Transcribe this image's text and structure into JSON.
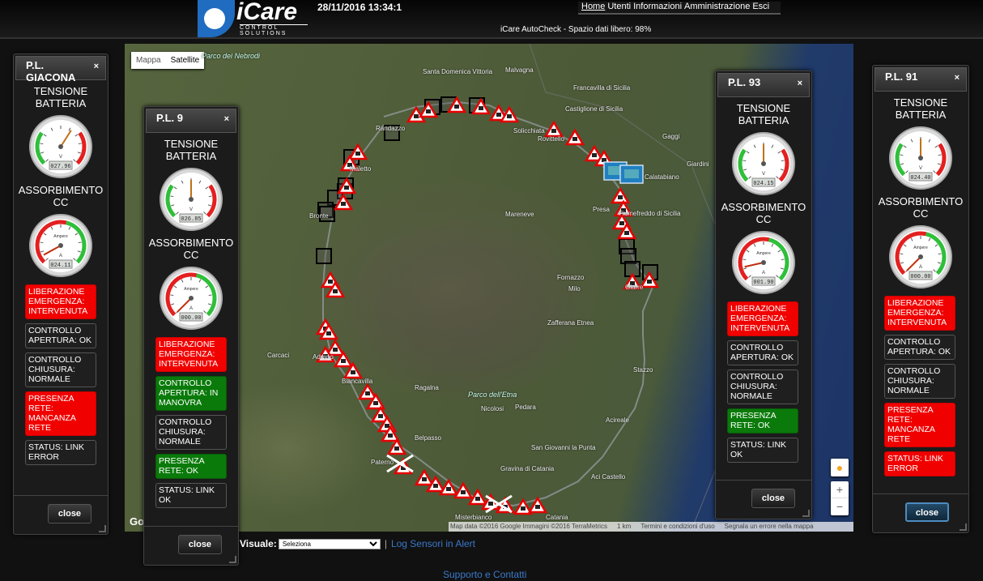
{
  "header": {
    "logo": {
      "brand": "iCare",
      "sub": "CONTROL SOLUTIONS"
    },
    "datetime": "28/11/2016 13:34:1",
    "nav": [
      "Home",
      "Utenti",
      "Informazioni",
      "Amministrazione",
      "Esci"
    ],
    "storage": "iCare AutoCheck - Spazio dati libero: 98%"
  },
  "map": {
    "map_types": [
      "Mappa",
      "Satellite"
    ],
    "selected_map_type": "Satellite",
    "attribution": [
      "Map data ©2016 Google Immagini ©2016 TerraMetrics",
      "1 km",
      "Termini e condizioni d'uso",
      "Segnala un errore nella mappa"
    ],
    "google_logo": "Google",
    "zoom_in": "+",
    "zoom_out": "−",
    "place_labels": [
      "Parco dei Nebrodi",
      "Santa Domenica Vittoria",
      "Malvagna",
      "Francavilla di Sicilia",
      "Castiglione di Sicilia",
      "Solicchiata",
      "Rovittello",
      "Randazzo",
      "Maletto",
      "Bronte",
      "Fiumefreddo di Sicilia",
      "Calatabiano",
      "Giardini",
      "Gaggi",
      "Mareneve",
      "Presa",
      "Fornazzo",
      "Milo",
      "Giarre",
      "Zafferana Etnea",
      "Adrano",
      "Biancavilla",
      "Carcaci",
      "Ragalna",
      "Parco dell'Etna",
      "Pedara",
      "Nicolosi",
      "Acireale",
      "Stazzo",
      "Belpasso",
      "San Giovanni la Punta",
      "Gravina di Catania",
      "Aci Castello",
      "Paternò",
      "Misterbianco",
      "Catania"
    ],
    "icon_colors": {
      "warning": "#e60000",
      "box": "#000000",
      "device": "#1f7fc0",
      "route": "#9aa0a6"
    }
  },
  "panels": [
    {
      "title": "P.L. GIACONA",
      "close_icon": "×",
      "gauge1": {
        "label": "TENSIONE BATTERIA",
        "unit": "V",
        "readout": "027.96",
        "value_fraction": 0.62
      },
      "gauge2": {
        "label": "ASSORBIMENTO CC",
        "unit": "A",
        "caption": "Ampere",
        "readout": "024.11",
        "value_fraction": 0.06
      },
      "statuses": [
        {
          "text": "LIBERAZIONE EMERGENZA: INTERVENUTA",
          "color": "red"
        },
        {
          "text": "CONTROLLO APERTURA: OK",
          "color": "gray"
        },
        {
          "text": "CONTROLLO CHIUSURA: NORMALE",
          "color": "gray"
        },
        {
          "text": "PRESENZA RETE: MANCANZA RETE",
          "color": "red"
        },
        {
          "text": "STATUS: LINK ERROR",
          "color": "gray"
        }
      ],
      "close_label": "close"
    },
    {
      "title": "P.L. 9",
      "close_icon": "×",
      "gauge1": {
        "label": "TENSIONE BATTERIA",
        "unit": "V",
        "readout": "026.85",
        "value_fraction": 0.5
      },
      "gauge2": {
        "label": "ASSORBIMENTO CC",
        "unit": "A",
        "caption": "Ampere",
        "readout": "000.00",
        "value_fraction": 0.0
      },
      "statuses": [
        {
          "text": "LIBERAZIONE EMERGENZA: INTERVENUTA",
          "color": "red"
        },
        {
          "text": "CONTROLLO APERTURA: IN MANOVRA",
          "color": "green"
        },
        {
          "text": "CONTROLLO CHIUSURA: NORMALE",
          "color": "gray"
        },
        {
          "text": "PRESENZA RETE: OK",
          "color": "green"
        },
        {
          "text": "STATUS: LINK OK",
          "color": "gray"
        }
      ],
      "close_label": "close"
    },
    {
      "title": "P.L. 93",
      "close_icon": "×",
      "gauge1": {
        "label": "TENSIONE BATTERIA",
        "unit": "V",
        "readout": "024.15",
        "value_fraction": 0.5
      },
      "gauge2": {
        "label": "ASSORBIMENTO CC",
        "unit": "A",
        "caption": "Ampere",
        "readout": "001.90",
        "value_fraction": 0.12
      },
      "statuses": [
        {
          "text": "LIBERAZIONE EMERGENZA: INTERVENUTA",
          "color": "red"
        },
        {
          "text": "CONTROLLO APERTURA: OK",
          "color": "gray"
        },
        {
          "text": "CONTROLLO CHIUSURA: NORMALE",
          "color": "gray"
        },
        {
          "text": "PRESENZA RETE: OK",
          "color": "green"
        },
        {
          "text": "STATUS: LINK OK",
          "color": "gray"
        }
      ],
      "close_label": "close"
    },
    {
      "title": "P.L. 91",
      "close_icon": "×",
      "gauge1": {
        "label": "TENSIONE BATTERIA",
        "unit": "V",
        "readout": "024.40",
        "value_fraction": 0.5
      },
      "gauge2": {
        "label": "ASSORBIMENTO CC",
        "unit": "A",
        "caption": "Ampere",
        "readout": "000.00",
        "value_fraction": 0.0
      },
      "statuses": [
        {
          "text": "LIBERAZIONE EMERGENZA: INTERVENUTA",
          "color": "red"
        },
        {
          "text": "CONTROLLO APERTURA: OK",
          "color": "gray"
        },
        {
          "text": "CONTROLLO CHIUSURA: NORMALE",
          "color": "gray"
        },
        {
          "text": "PRESENZA RETE: MANCANZA RETE",
          "color": "red"
        },
        {
          "text": "STATUS: LINK ERROR",
          "color": "red"
        }
      ],
      "close_label": "close"
    }
  ],
  "footer": {
    "visual_label": "Visuale:",
    "select_value": "Seleziona",
    "separator": "|",
    "log_link": "Log Sensori in Alert",
    "support": "Supporto e Contatti"
  }
}
